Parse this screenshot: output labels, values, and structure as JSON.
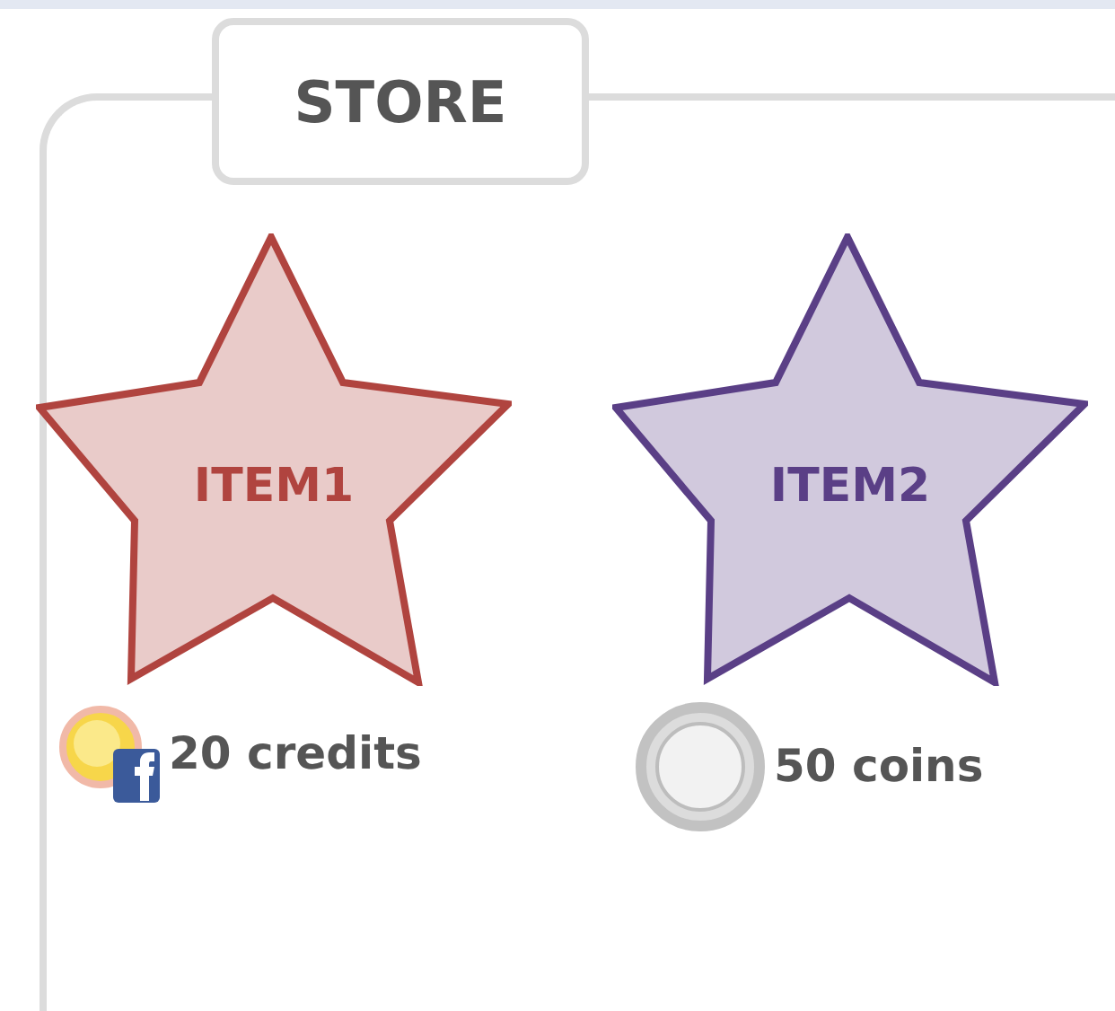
{
  "store": {
    "title": "STORE",
    "items": [
      {
        "name": "ITEM1",
        "color": "#b0443f",
        "kind": "credits",
        "price": "20 credits"
      },
      {
        "name": "ITEM2",
        "color": "#5a3f86",
        "kind": "coins",
        "price": "50 coins"
      }
    ]
  }
}
